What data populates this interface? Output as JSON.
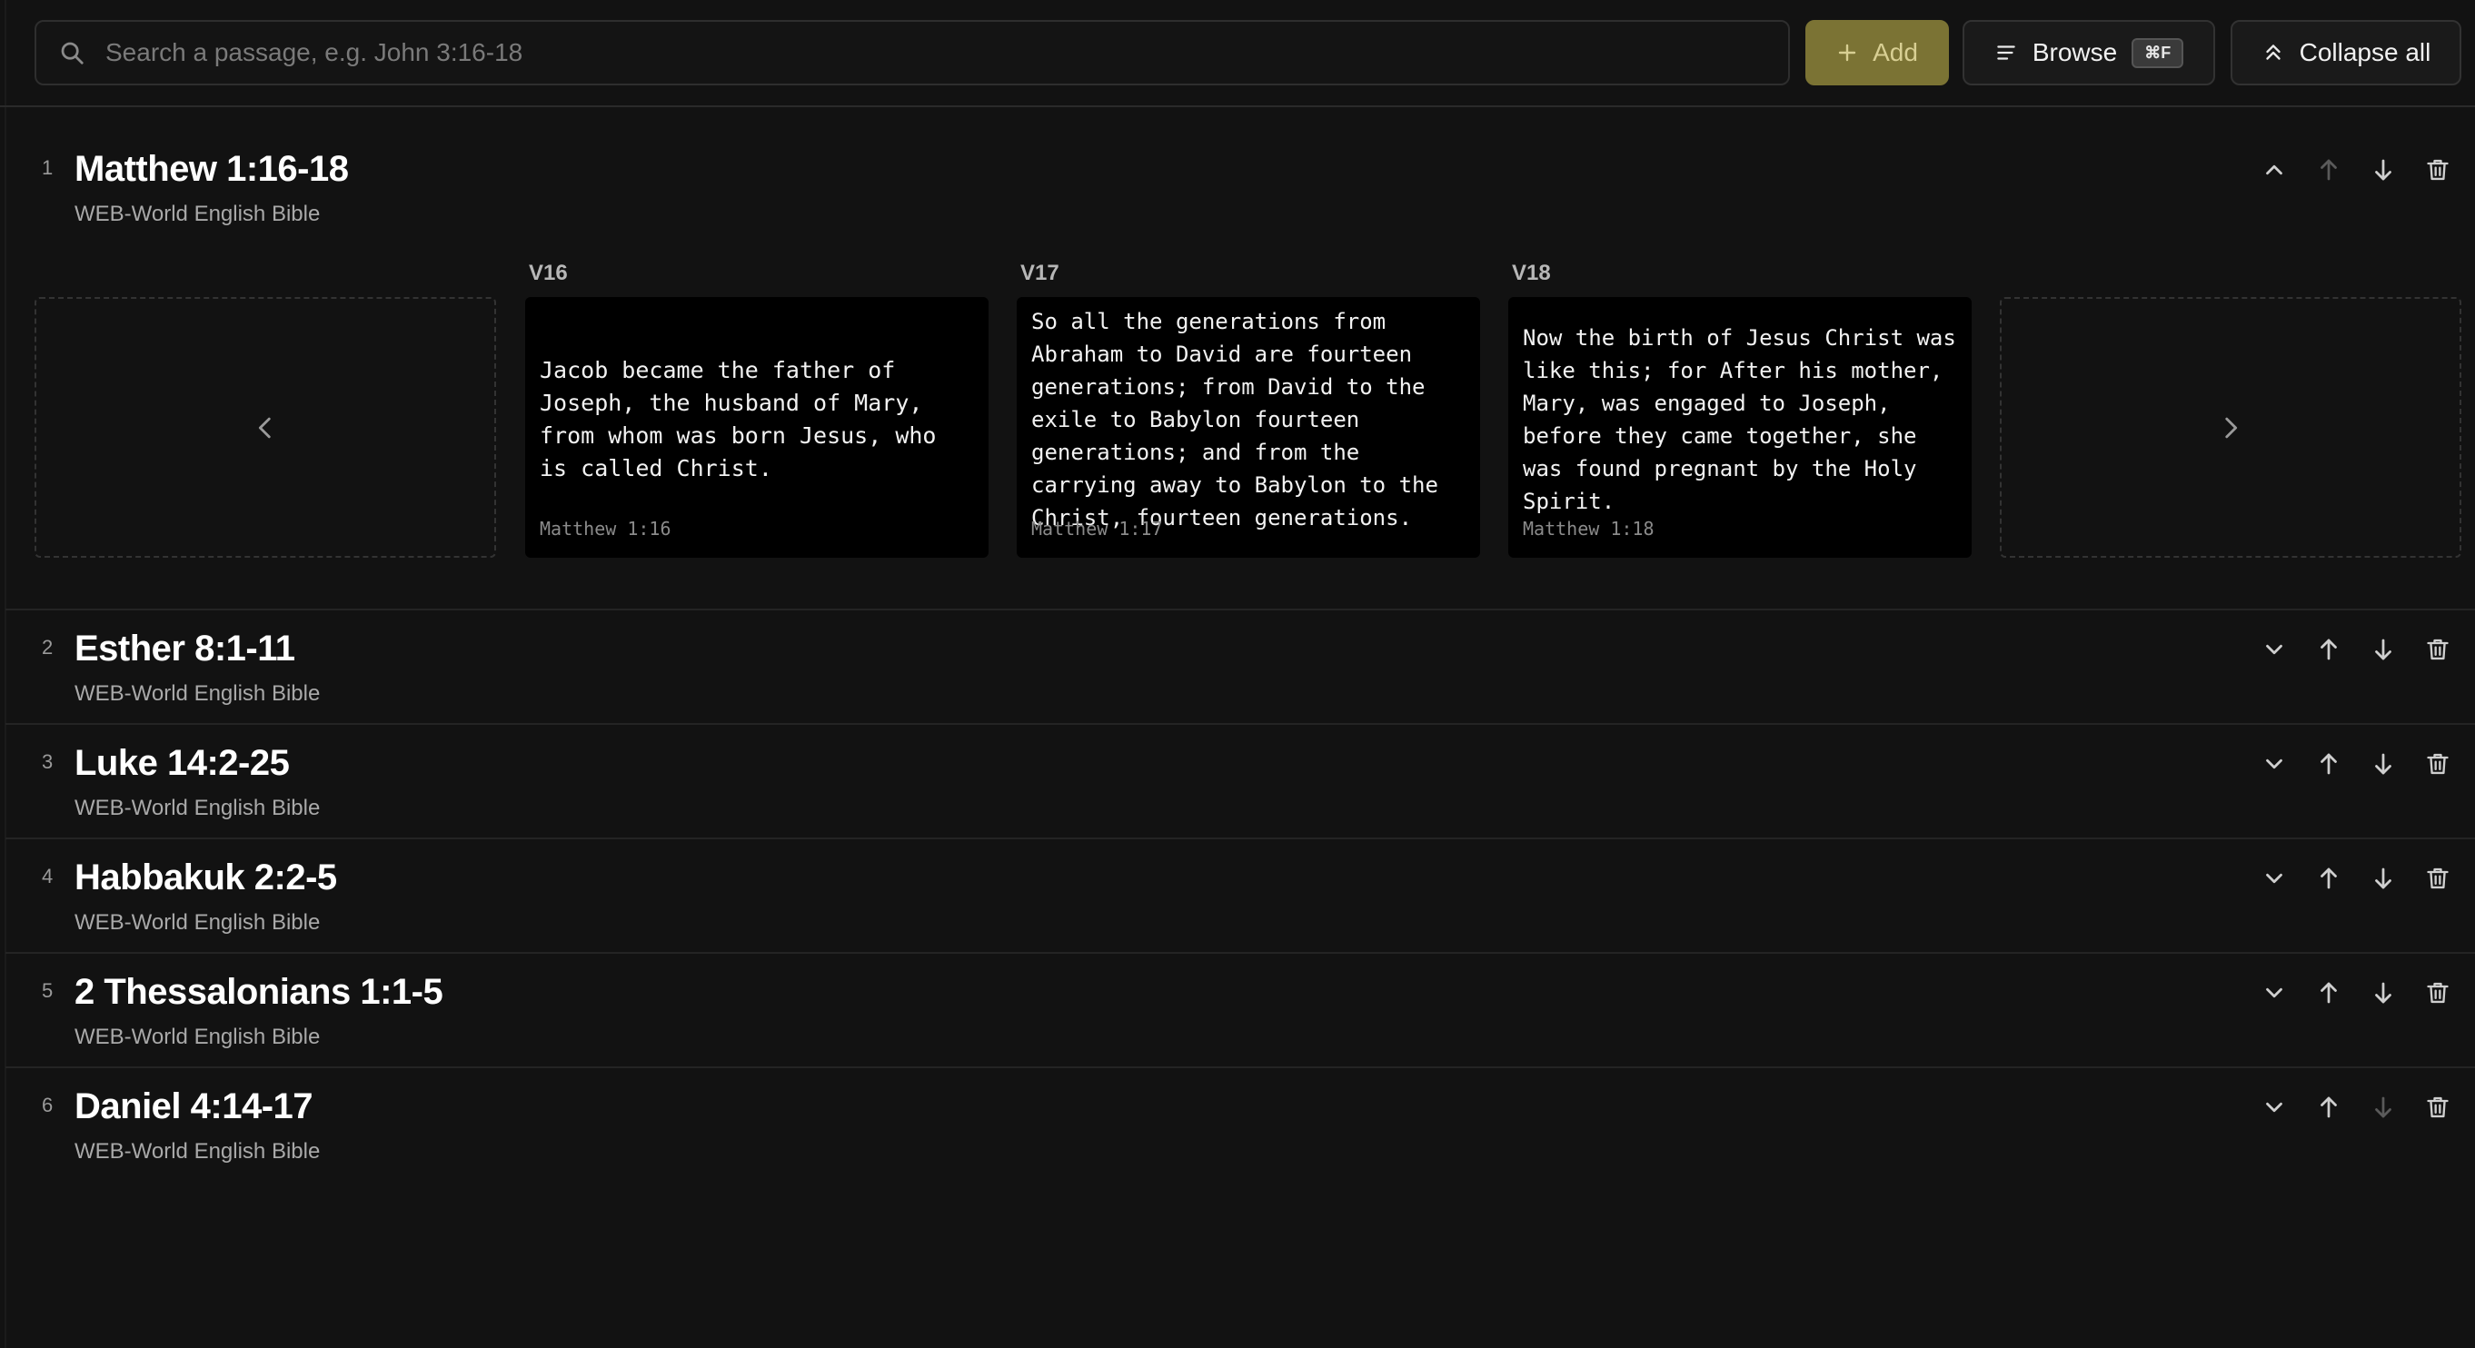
{
  "search": {
    "placeholder": "Search a passage, e.g. John 3:16-18"
  },
  "toolbar": {
    "add_label": "Add",
    "browse_label": "Browse",
    "browse_shortcut": "⌘F",
    "collapse_label": "Collapse all",
    "accent_color": "#7b7334"
  },
  "passages": [
    {
      "index": "1",
      "title": "Matthew 1:16-18",
      "version": "WEB-World English Bible"
    },
    {
      "index": "2",
      "title": "Esther 8:1-11",
      "version": "WEB-World English Bible"
    },
    {
      "index": "3",
      "title": "Luke 14:2-25",
      "version": "WEB-World English Bible"
    },
    {
      "index": "4",
      "title": "Habbakuk 2:2-5",
      "version": "WEB-World English Bible"
    },
    {
      "index": "5",
      "title": "2 Thessalonians 1:1-5",
      "version": "WEB-World English Bible"
    },
    {
      "index": "6",
      "title": "Daniel 4:14-17",
      "version": "WEB-World English Bible"
    }
  ],
  "verses": [
    {
      "label": "V16",
      "text": "Jacob became the father of Joseph, the husband of Mary, from whom was born Jesus, who is called Christ.",
      "ref": "Matthew 1:16"
    },
    {
      "label": "V17",
      "text": "So all the generations from Abraham to David are fourteen generations; from David to the exile to Babylon fourteen generations; and from the carrying away to Babylon to the Christ, fourteen generations.",
      "ref": "Matthew 1:17"
    },
    {
      "label": "V18",
      "text": "Now the birth of Jesus Christ was like this; for After his mother, Mary, was engaged to Joseph, before they came together, she was found pregnant by the Holy Spirit.",
      "ref": "Matthew 1:18"
    }
  ]
}
